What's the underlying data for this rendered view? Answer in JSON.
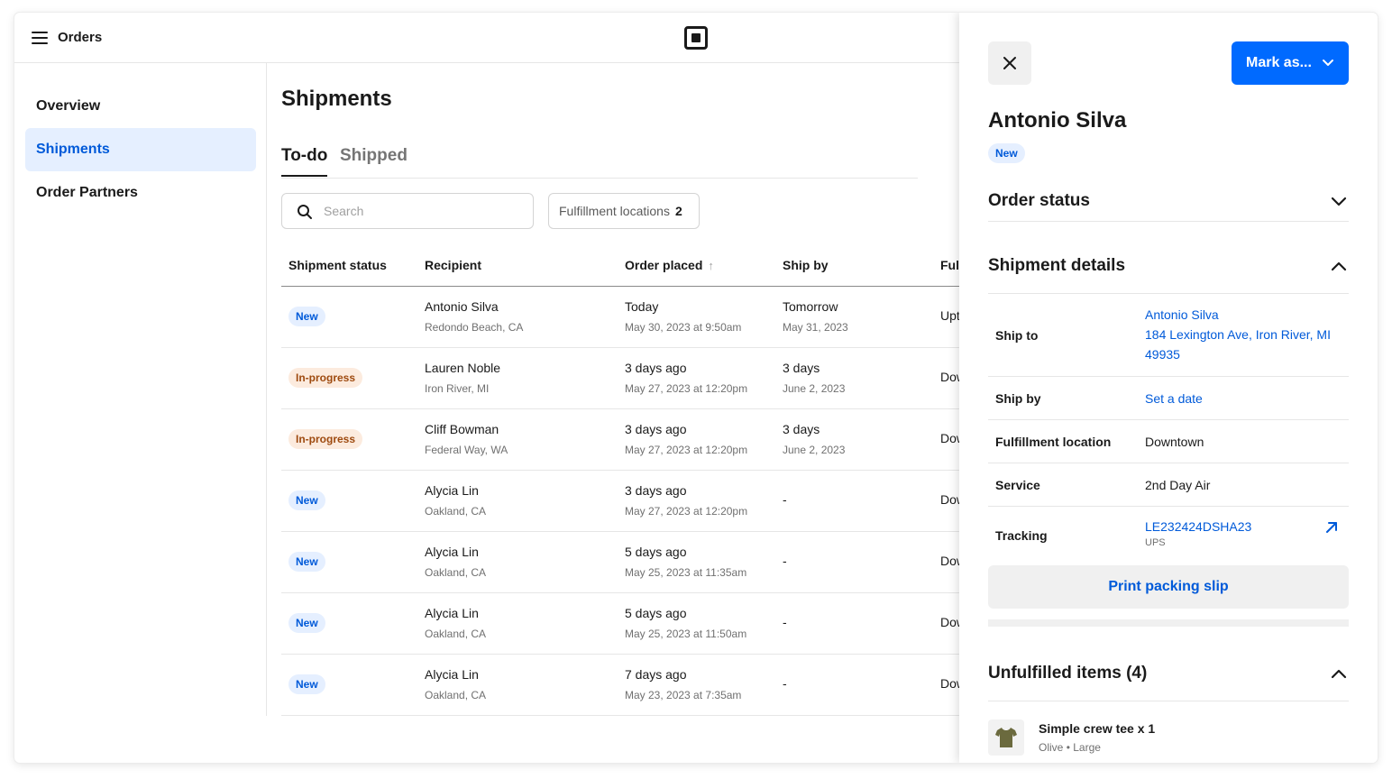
{
  "topbar": {
    "app_title": "Orders"
  },
  "sidebar": {
    "items": [
      {
        "label": "Overview"
      },
      {
        "label": "Shipments"
      },
      {
        "label": "Order Partners"
      }
    ]
  },
  "main": {
    "title": "Shipments",
    "tabs": [
      {
        "label": "To-do"
      },
      {
        "label": "Shipped"
      }
    ],
    "search_placeholder": "Search",
    "filter": {
      "label": "Fulfillment locations",
      "count": "2"
    }
  },
  "table": {
    "headers": [
      "Shipment status",
      "Recipient",
      "Order placed",
      "Ship by",
      "Ful"
    ],
    "sort_arrow": "↑",
    "rows": [
      {
        "status": "New",
        "name": "Antonio Silva",
        "location": "Redondo Beach, CA",
        "placed": "Today",
        "placed_detail": "May 30, 2023 at 9:50am",
        "ship_by": "Tomorrow",
        "ship_by_detail": "May 31, 2023",
        "fulfillment": "Upt"
      },
      {
        "status": "In-progress",
        "name": "Lauren Noble",
        "location": "Iron River, MI",
        "placed": "3 days ago",
        "placed_detail": "May 27, 2023 at 12:20pm",
        "ship_by": "3 days",
        "ship_by_detail": "June 2, 2023",
        "fulfillment": "Dow"
      },
      {
        "status": "In-progress",
        "name": "Cliff Bowman",
        "location": "Federal Way, WA",
        "placed": "3 days ago",
        "placed_detail": "May 27, 2023 at 12:20pm",
        "ship_by": "3 days",
        "ship_by_detail": "June 2, 2023",
        "fulfillment": "Dow"
      },
      {
        "status": "New",
        "name": "Alycia Lin",
        "location": "Oakland, CA",
        "placed": "3 days ago",
        "placed_detail": "May 27, 2023 at 12:20pm",
        "ship_by": "-",
        "ship_by_detail": "",
        "fulfillment": "Dow"
      },
      {
        "status": "New",
        "name": "Alycia Lin",
        "location": "Oakland, CA",
        "placed": "5 days ago",
        "placed_detail": "May 25, 2023 at 11:35am",
        "ship_by": "-",
        "ship_by_detail": "",
        "fulfillment": "Dow"
      },
      {
        "status": "New",
        "name": "Alycia Lin",
        "location": "Oakland, CA",
        "placed": "5 days ago",
        "placed_detail": "May 25, 2023 at 11:50am",
        "ship_by": "-",
        "ship_by_detail": "",
        "fulfillment": "Dow"
      },
      {
        "status": "New",
        "name": "Alycia Lin",
        "location": "Oakland, CA",
        "placed": "7 days ago",
        "placed_detail": "May 23, 2023 at 7:35am",
        "ship_by": "-",
        "ship_by_detail": "",
        "fulfillment": "Dow"
      }
    ]
  },
  "panel": {
    "mark_as_label": "Mark as...",
    "customer_name": "Antonio Silva",
    "status_badge": "New",
    "order_status_title": "Order status",
    "shipment_details_title": "Shipment details",
    "details": {
      "ship_to_label": "Ship to",
      "ship_to_name": "Antonio Silva",
      "ship_to_address_1": "184 Lexington Ave, Iron River, MI",
      "ship_to_address_2": "49935",
      "ship_by_label": "Ship by",
      "ship_by_value": "Set a date",
      "location_label": "Fulfillment location",
      "location_value": "Downtown",
      "service_label": "Service",
      "service_value": "2nd Day Air",
      "tracking_label": "Tracking",
      "tracking_number": "LE232424DSHA23",
      "tracking_carrier": "UPS"
    },
    "print_label": "Print packing slip",
    "unfulfilled_title": "Unfulfilled items (4)",
    "item": {
      "name": "Simple crew tee x 1",
      "color": "Olive",
      "separator": "•",
      "size": "Large"
    }
  },
  "colors": {
    "accent": "#006aff",
    "link": "#005ad9",
    "new_badge_bg": "#e5efff",
    "progress_badge_bg": "#fcebde",
    "progress_badge_text": "#9e4a0f"
  },
  "icons": [
    "hamburger-icon",
    "square-logo",
    "search-icon",
    "sort-up-icon",
    "close-icon",
    "chevron-down-icon",
    "chevron-up-icon",
    "external-link-icon",
    "tshirt-icon"
  ]
}
